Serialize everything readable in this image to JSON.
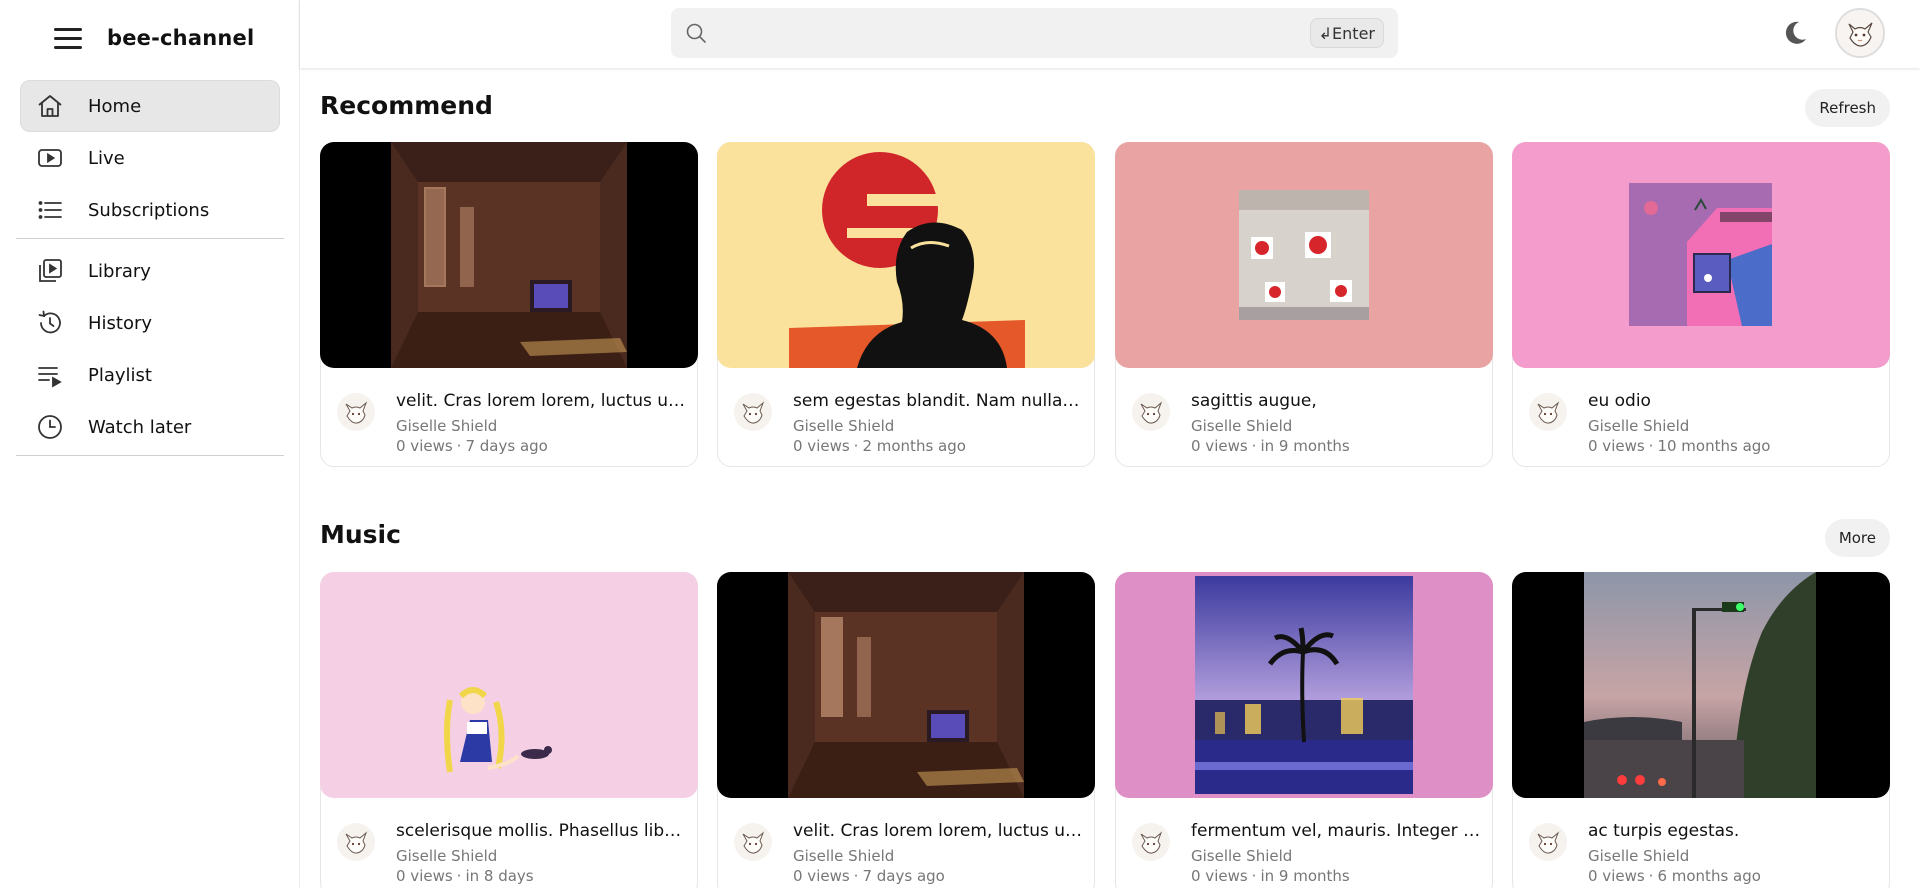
{
  "brand": {
    "name": "bee-channel"
  },
  "nav": {
    "items": [
      {
        "label": "Home",
        "icon": "home-icon",
        "active": true
      },
      {
        "label": "Live",
        "icon": "live-icon"
      },
      {
        "label": "Subscriptions",
        "icon": "list-icon"
      },
      {
        "label": "Library",
        "icon": "library-icon"
      },
      {
        "label": "History",
        "icon": "history-icon"
      },
      {
        "label": "Playlist",
        "icon": "playlist-icon"
      },
      {
        "label": "Watch later",
        "icon": "clock-icon"
      }
    ]
  },
  "search": {
    "placeholder": "",
    "enter_label": "↲Enter"
  },
  "sections": [
    {
      "title": "Recommend",
      "button": "Refresh",
      "videos": [
        {
          "title": "velit. Cras lorem lorem, luctus ut, pellentesque",
          "channel": "Giselle Shield",
          "views": "0 views",
          "time": "7 days ago",
          "thumb": "dark-room"
        },
        {
          "title": "sem egestas blandit. Nam nulla magna, malesuada",
          "channel": "Giselle Shield",
          "views": "0 views",
          "time": "2 months ago",
          "thumb": "sun-portrait"
        },
        {
          "title": "sagittis augue,",
          "channel": "Giselle Shield",
          "views": "0 views",
          "time": "in 9 months",
          "thumb": "strawberry-train"
        },
        {
          "title": "eu odio",
          "channel": "Giselle Shield",
          "views": "0 views",
          "time": "10 months ago",
          "thumb": "pink-window"
        }
      ]
    },
    {
      "title": "Music",
      "button": "More",
      "videos": [
        {
          "title": "scelerisque mollis. Phasellus libero mauris, aliquam",
          "channel": "Giselle Shield",
          "views": "0 views",
          "time": "in 8 days",
          "thumb": "sailor-moon"
        },
        {
          "title": "velit. Cras lorem lorem, luctus ut, pellentesque",
          "channel": "Giselle Shield",
          "views": "0 views",
          "time": "7 days ago",
          "thumb": "dark-room"
        },
        {
          "title": "fermentum vel, mauris. Integer sem elit, pharetra",
          "channel": "Giselle Shield",
          "views": "0 views",
          "time": "in 9 months",
          "thumb": "palm-city"
        },
        {
          "title": "ac turpis egestas.",
          "channel": "Giselle Shield",
          "views": "0 views",
          "time": "6 months ago",
          "thumb": "evening-road"
        }
      ]
    }
  ],
  "colors": {
    "accent_active_bg": "#e7e7e7",
    "card_border": "#e6e6e6",
    "muted_text": "#777777"
  }
}
